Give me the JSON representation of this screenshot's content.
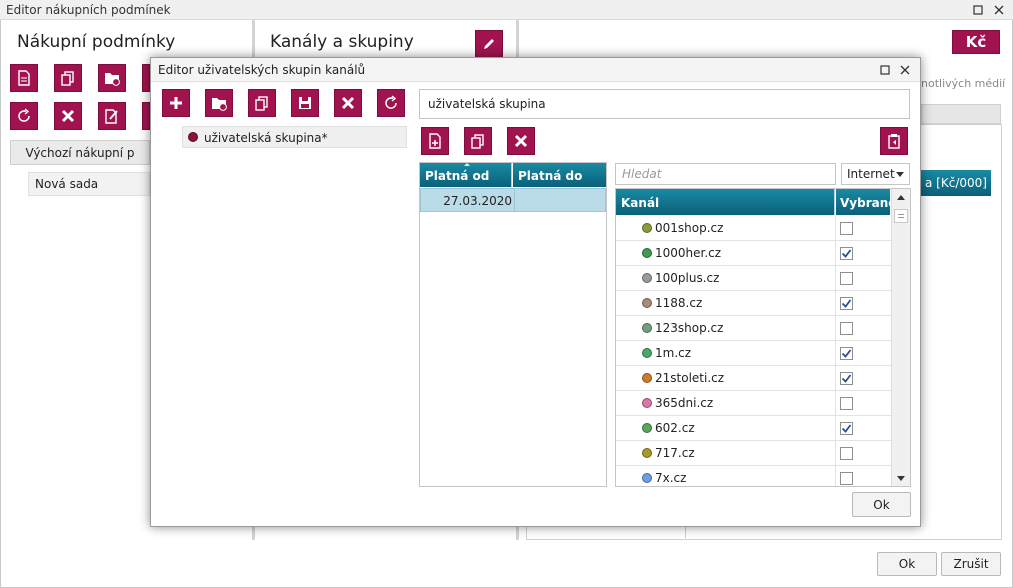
{
  "window": {
    "title": "Editor nákupních podmínek"
  },
  "left_pane": {
    "title": "Nákupní podmínky",
    "default_button": "Výchozí nákupní p",
    "list_item": "Nová sada"
  },
  "middle_pane": {
    "title": "Kanály a skupiny"
  },
  "right_pane": {
    "kc_button": "Kč",
    "side_text": "notlivých médií",
    "grid_header": "a [Kč/000]"
  },
  "footer": {
    "ok": "Ok",
    "cancel": "Zrušit"
  },
  "dialog": {
    "title": "Editor uživatelských skupin kanálů",
    "group_item": "uživatelská skupina*",
    "group_name_value": "uživatelská skupina",
    "validity_headers": {
      "from": "Platná od",
      "to": "Platná do"
    },
    "validity_rows": [
      {
        "from": "27.03.2020",
        "to": ""
      }
    ],
    "search_placeholder": "Hledat",
    "filter_selected": "Internet",
    "channel_headers": {
      "name": "Kanál",
      "selected": "Vybrané"
    },
    "channels": [
      {
        "name": "001shop.cz",
        "color": "#8c9a3c",
        "checked": false
      },
      {
        "name": "1000her.cz",
        "color": "#3f9a54",
        "checked": true
      },
      {
        "name": "100plus.cz",
        "color": "#9a9a9a",
        "checked": false
      },
      {
        "name": "1188.cz",
        "color": "#a88a7c",
        "checked": true
      },
      {
        "name": "123shop.cz",
        "color": "#6f9f7c",
        "checked": false
      },
      {
        "name": "1m.cz",
        "color": "#4aa86a",
        "checked": true
      },
      {
        "name": "21stoleti.cz",
        "color": "#d07a2a",
        "checked": true
      },
      {
        "name": "365dni.cz",
        "color": "#d879a8",
        "checked": false
      },
      {
        "name": "602.cz",
        "color": "#5aa65a",
        "checked": true
      },
      {
        "name": "717.cz",
        "color": "#a89a2a",
        "checked": false
      },
      {
        "name": "7x.cz",
        "color": "#6c9ee8",
        "checked": false
      }
    ],
    "ok": "Ok",
    "accent_color": "#a0134f",
    "header_color": "#0a6f89"
  }
}
